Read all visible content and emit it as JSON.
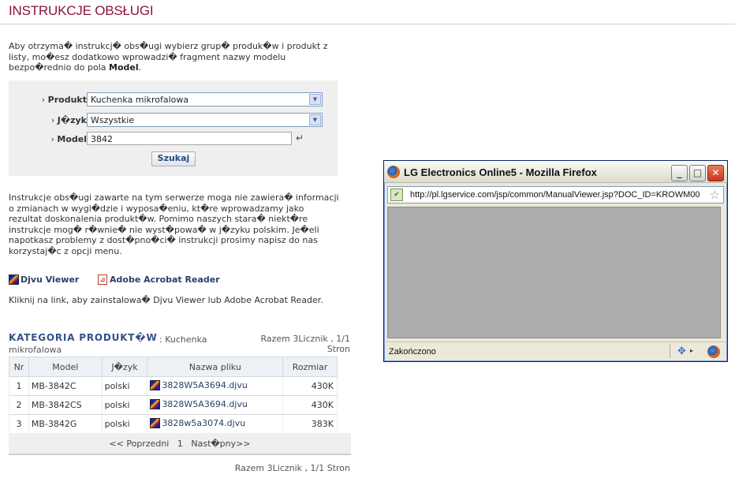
{
  "page": {
    "title": "INSTRUKCJE OBSŁUGI",
    "intro_text": "Aby otrzyma� instrukcj� obs�ugi wybierz grup� produk�w i produkt z listy, mo�esz dodatkowo wprowadzi� fragment nazwy modelu bezpo�rednio do pola ",
    "intro_bold": "Model",
    "intro_end": "."
  },
  "search": {
    "product_label": "Produkt",
    "product_value": "Kuchenka mikrofalowa",
    "language_label": "J�zyk",
    "language_value": "Wszystkie",
    "model_label": "Model",
    "model_value": "3842",
    "search_button": "Szukaj"
  },
  "notes": "Instrukcje obs�ugi zawarte na tym serwerze moga nie zawiera� informacji o zmianach w wygl�dzie i wyposa�eniu, kt�re wprowadzamy jako rezultat doskonalenia produkt�w. Pomimo naszych stara� niekt�re instrukcje mog� r�wnie� nie wyst�powa� w j�zyku polskim. Je�eli napotkasz problemy z dost�pno�ci� instrukcji prosimy napisz do nas korzystaj�c z opcji menu.",
  "viewers": {
    "djvu": "Djvu Viewer",
    "acrobat": "Adobe Acrobat Reader",
    "install_note": "Kliknij na link, aby zainstalowa� Djvu Viewer lub Adobe Acrobat Reader."
  },
  "category": {
    "title": "KATEGORIA PRODUKT�W",
    "subtitle_part1": ": Kuchenka",
    "subtitle_part2": "mikrofalowa",
    "counter_top_line1": "Razem 3Licznik , 1/1",
    "counter_top_line2": "Stron"
  },
  "table": {
    "headers": [
      "Nr",
      "Model",
      "J�zyk",
      "Nazwa pliku",
      "Rozmiar"
    ],
    "rows": [
      {
        "nr": "1",
        "model": "MB-3842C",
        "language": "polski",
        "file": "3828W5A3694.djvu",
        "size": "430K"
      },
      {
        "nr": "2",
        "model": "MB-3842CS",
        "language": "polski",
        "file": "3828W5A3694.djvu",
        "size": "430K"
      },
      {
        "nr": "3",
        "model": "MB-3842G",
        "language": "polski",
        "file": "3828w5a3074.djvu",
        "size": "383K"
      }
    ]
  },
  "pager": {
    "prev": "<< Poprzedni",
    "current": "1",
    "next": "Nast�pny>>"
  },
  "counter_bottom": "Razem 3Licznik , 1/1 Stron",
  "popup": {
    "window_title": "LG Electronics Online5 - Mozilla Firefox",
    "url": "http://pl.lgservice.com/jsp/common/ManualViewer.jsp?DOC_ID=KROWM00",
    "status": "Zakończono",
    "minimize_glyph": "_",
    "maximize_glyph": "□",
    "close_glyph": "✕"
  },
  "colors": {
    "brand": "#8b1538",
    "link": "#2b3f6b",
    "category": "#34508a"
  }
}
